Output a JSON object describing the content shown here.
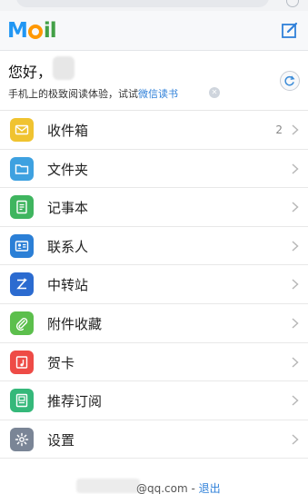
{
  "header": {
    "logo_text": "Mail"
  },
  "greeting": {
    "hello": "您好，",
    "subtitle_prefix": "手机上的极致阅读体验，试试",
    "subtitle_link": "微信读书"
  },
  "menu": {
    "items": [
      {
        "label": "收件箱",
        "count": "2",
        "icon": "inbox-icon",
        "color": "#f0c330"
      },
      {
        "label": "文件夹",
        "count": "",
        "icon": "folder-icon",
        "color": "#3ea1e0"
      },
      {
        "label": "记事本",
        "count": "",
        "icon": "notepad-icon",
        "color": "#3fb55f"
      },
      {
        "label": "联系人",
        "count": "",
        "icon": "contacts-icon",
        "color": "#2b7fd6"
      },
      {
        "label": "中转站",
        "count": "",
        "icon": "transfer-icon",
        "color": "#2b6bd0"
      },
      {
        "label": "附件收藏",
        "count": "",
        "icon": "attachment-icon",
        "color": "#5cbf4c"
      },
      {
        "label": "贺卡",
        "count": "",
        "icon": "greeting-card-icon",
        "color": "#ee4b46"
      },
      {
        "label": "推荐订阅",
        "count": "",
        "icon": "subscription-icon",
        "color": "#35b87a"
      },
      {
        "label": "设置",
        "count": "",
        "icon": "settings-icon",
        "color": "#7a8596"
      }
    ]
  },
  "footer": {
    "email_suffix": "@qq.com - ",
    "logout": "退出"
  }
}
